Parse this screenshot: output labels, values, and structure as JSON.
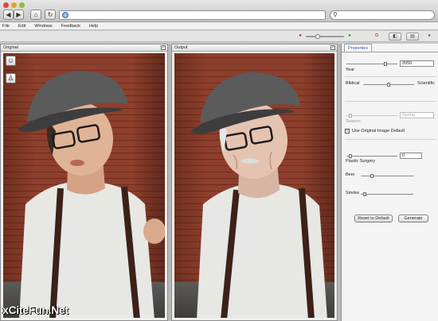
{
  "menu": [
    "File",
    "Edit",
    "Windows",
    "Feedback",
    "Help"
  ],
  "panels": {
    "original_title": "Original",
    "output_title": "Output"
  },
  "properties": {
    "tab": "Properties",
    "year_label": "Year",
    "year_value": "2050",
    "year_slider": 0.8,
    "biblical_label": "Biblical",
    "scientific_label": "Scientific",
    "biblical_slider": 0.5,
    "season_label": "Season",
    "spring_value": "Spring",
    "season_slider": 0.05,
    "use_original_label": "Use Original Image Default",
    "use_original_checked": true,
    "plastic_label": "Plastic Surgery",
    "plastic_value": "0",
    "plastic_slider": 0.05,
    "beer_label": "Beer",
    "beer_slider": 0.2,
    "smoke_label": "Smoke",
    "smoke_slider": 0.05,
    "reset_label": "Reset to Default",
    "generate_label": "Generate"
  },
  "zoom_level": 0.3,
  "watermark": "xCiteFun.Net",
  "icons": [
    "back-arrow-icon",
    "forward-arrow-icon",
    "home-icon",
    "reload-icon",
    "globe-icon",
    "search-icon",
    "zoom-out-icon",
    "zoom-in-icon",
    "person-age-icon",
    "person-walking-icon"
  ]
}
